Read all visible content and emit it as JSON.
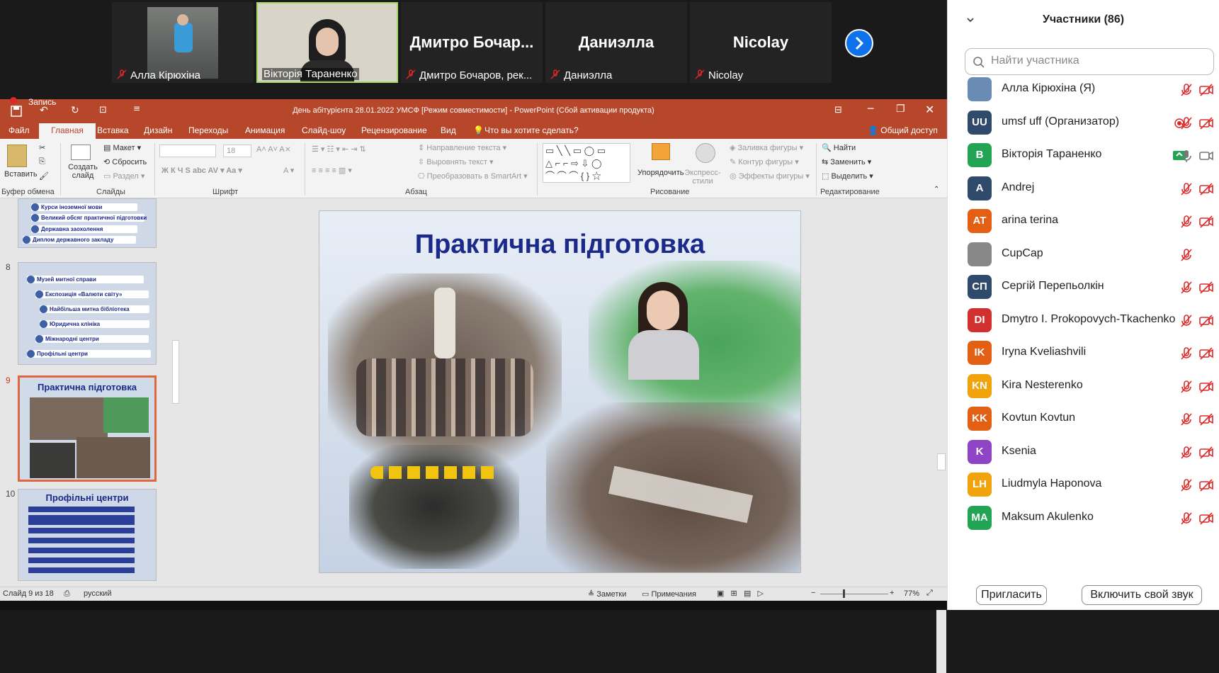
{
  "video_strip": {
    "tiles": [
      {
        "name": "Алла Кірюхіна",
        "muted": true,
        "type": "photo"
      },
      {
        "name": "Вікторія Тараненко",
        "muted": false,
        "type": "camera",
        "active": true
      },
      {
        "name": "Дмитро Бочаров, рек...",
        "big": "Дмитро  Бочар...",
        "muted": true,
        "type": "text"
      },
      {
        "name": "Даниэлла",
        "big": "Даниэлла",
        "muted": true,
        "type": "text"
      },
      {
        "name": "Nicolay",
        "big": "Nicolay",
        "muted": true,
        "type": "text"
      }
    ],
    "next_icon": "chevron-right-icon"
  },
  "recording": {
    "label": "Запись"
  },
  "ppt": {
    "title": "День абітурієнта 28.01.2022 УМСФ [Режим совместимости] - PowerPoint (Сбой активации продукта)",
    "menu": [
      "Файл",
      "Главная",
      "Вставка",
      "Дизайн",
      "Переходы",
      "Анимация",
      "Слайд-шоу",
      "Рецензирование",
      "Вид"
    ],
    "tell_me": "Что вы хотите сделать?",
    "share": "Общий доступ",
    "ribbon": {
      "paste": "Вставить",
      "new_slide": "Создать слайд",
      "layout": "Макет",
      "reset": "Сбросить",
      "section": "Раздел",
      "font_size": "18",
      "text_direction": "Направление текста",
      "align_text": "Выровнять текст",
      "smartart": "Преобразовать в SmartArt",
      "arrange": "Упорядочить",
      "quick_styles": "Экспресс-стили",
      "shape_fill": "Заливка фигуры",
      "shape_outline": "Контур фигуры",
      "shape_effects": "Эффекты фигуры",
      "find": "Найти",
      "replace": "Заменить",
      "select": "Выделить",
      "groups": [
        "Буфер обмена",
        "Слайды",
        "Шрифт",
        "Абзац",
        "Рисование",
        "Редактирование"
      ]
    },
    "thumbnails": [
      {
        "num": "",
        "items": [
          "Курси іноземної мови",
          "Великий обсяг практичної підготовки",
          "Державна заохолення",
          "Диплом державного закладу"
        ]
      },
      {
        "num": "8",
        "items": [
          "Музей митної справи",
          "Експозиція «Валюти світу»",
          "Найбільша митна бібліотека",
          "Юридична клініка",
          "Міжнародні центри",
          "Профільні центри"
        ]
      },
      {
        "num": "9",
        "title": "Практична підготовка",
        "selected": true
      },
      {
        "num": "10",
        "title": "Профільні центри"
      }
    ],
    "slide_title": "Практична підготовка",
    "status": {
      "slide": "Слайд 9 из 18",
      "lang": "русский",
      "notes": "Заметки",
      "comments": "Примечания",
      "zoom": "77%"
    }
  },
  "participants": {
    "title": "Участники (86)",
    "search_placeholder": "Найти участника",
    "list": [
      {
        "name": "Алла Кірюхіна (Я)",
        "avatar": "",
        "color": "#6a8bb3",
        "mic": "muted",
        "video": "off"
      },
      {
        "name": "umsf uff (Организатор)",
        "avatar": "UU",
        "color": "#2f4a6b",
        "mic": "muted",
        "video": "off",
        "record": true
      },
      {
        "name": "Вікторія Тараненко",
        "avatar": "B",
        "color": "#23a455",
        "mic": "on",
        "video": "on",
        "share": true
      },
      {
        "name": "Andrej",
        "avatar": "A",
        "color": "#2f4a6b",
        "mic": "muted",
        "video": "off"
      },
      {
        "name": "arina terina",
        "avatar": "AT",
        "color": "#e35f14",
        "mic": "muted",
        "video": "off"
      },
      {
        "name": "CupCap",
        "avatar": "",
        "color": "#888888",
        "mic": "muted",
        "video": "none"
      },
      {
        "name": "Сергій Перепьолкін",
        "avatar": "СП",
        "color": "#2f4a6b",
        "mic": "muted",
        "video": "off"
      },
      {
        "name": "Dmytro I. Prokopovych-Tkachenko",
        "avatar": "DI",
        "color": "#d1302e",
        "mic": "muted",
        "video": "off"
      },
      {
        "name": "Iryna Kveliashvili",
        "avatar": "IK",
        "color": "#e35f14",
        "mic": "muted",
        "video": "off"
      },
      {
        "name": "Kira Nesterenko",
        "avatar": "KN",
        "color": "#f0a30a",
        "mic": "muted",
        "video": "off"
      },
      {
        "name": "Kovtun Kovtun",
        "avatar": "KK",
        "color": "#e35f14",
        "mic": "muted",
        "video": "off"
      },
      {
        "name": "Ksenia",
        "avatar": "K",
        "color": "#8e44c4",
        "mic": "muted",
        "video": "off"
      },
      {
        "name": "Liudmyla Haponova",
        "avatar": "LH",
        "color": "#f0a30a",
        "mic": "muted",
        "video": "off"
      },
      {
        "name": "Maksum Akulenko",
        "avatar": "MA",
        "color": "#23a455",
        "mic": "muted",
        "video": "off"
      }
    ],
    "invite": "Пригласить",
    "unmute": "Включить свой звук"
  }
}
